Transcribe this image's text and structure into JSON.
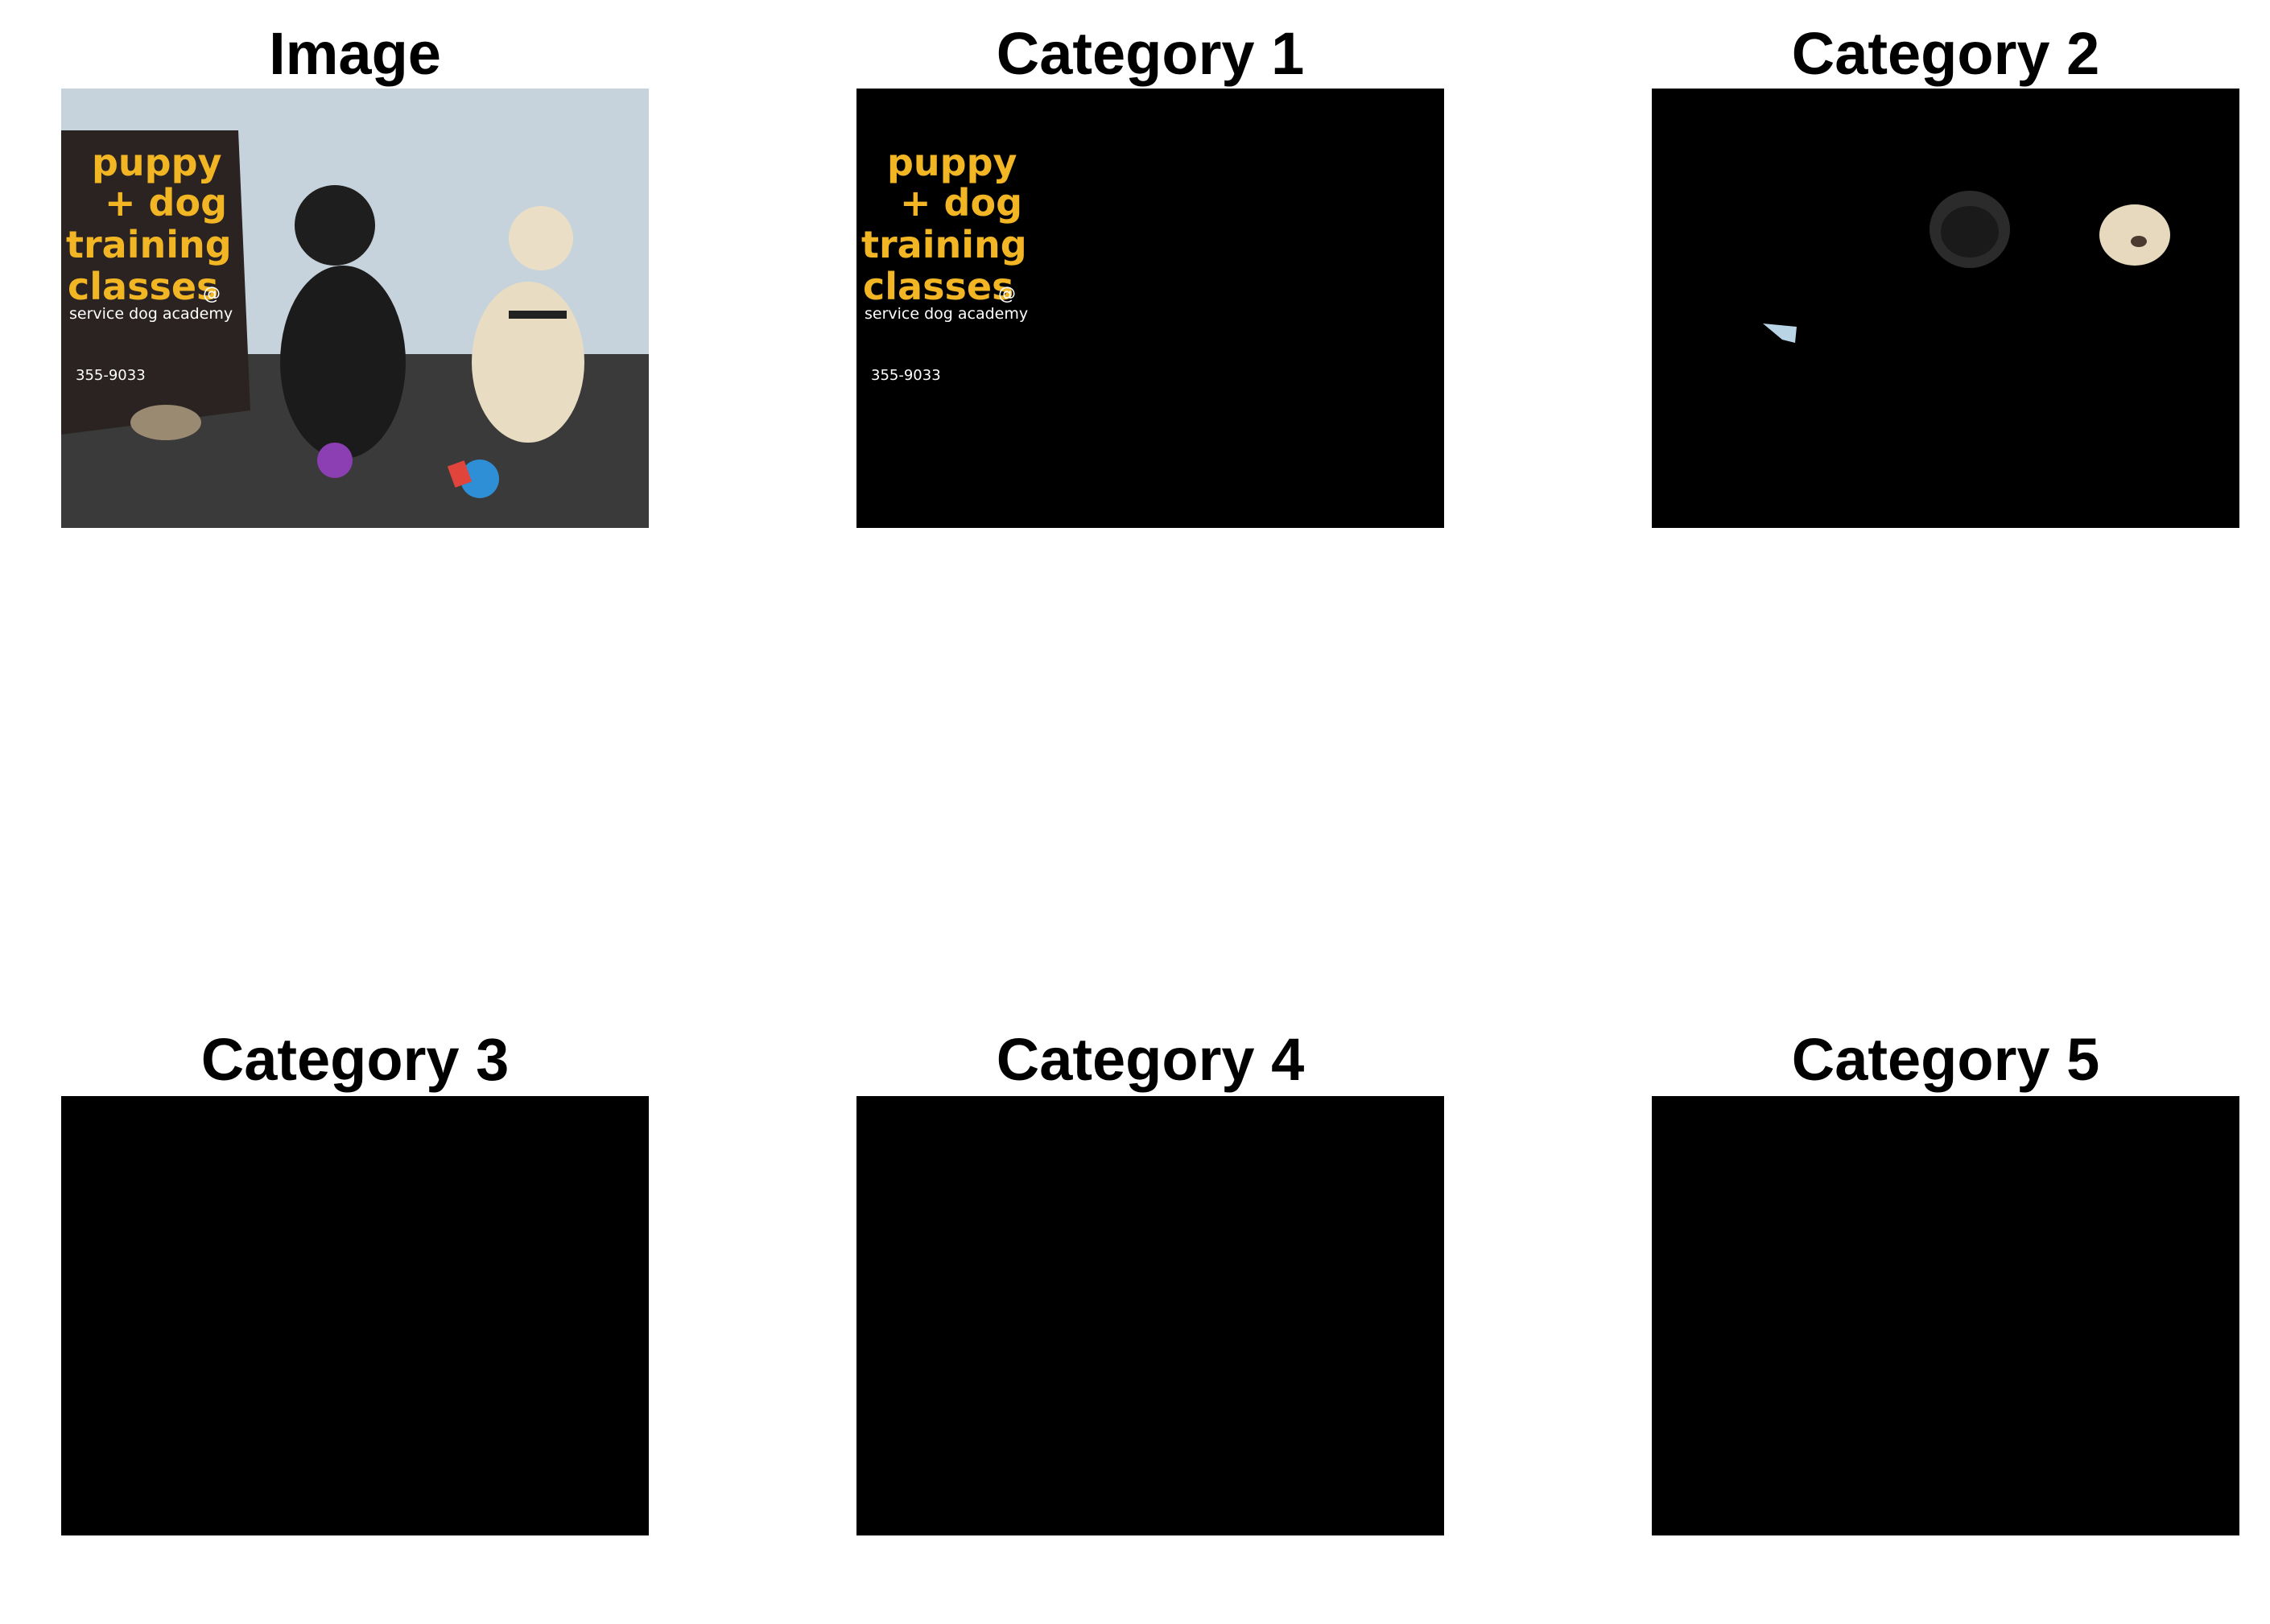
{
  "panels": [
    {
      "title": "Image"
    },
    {
      "title": "Category 1"
    },
    {
      "title": "Category 2"
    },
    {
      "title": "Category 3"
    },
    {
      "title": "Category 4"
    },
    {
      "title": "Category 5"
    }
  ],
  "sign": {
    "line1": "puppy",
    "line2": "+ dog",
    "line3": "training",
    "line4": "classes",
    "at": "@",
    "line5": "service dog academy",
    "phone": "355-9033"
  },
  "colors": {
    "background": "#000000",
    "sign_text": "#f2b624",
    "wall": "#c7d3dc",
    "floor": "#3a3a3a"
  }
}
